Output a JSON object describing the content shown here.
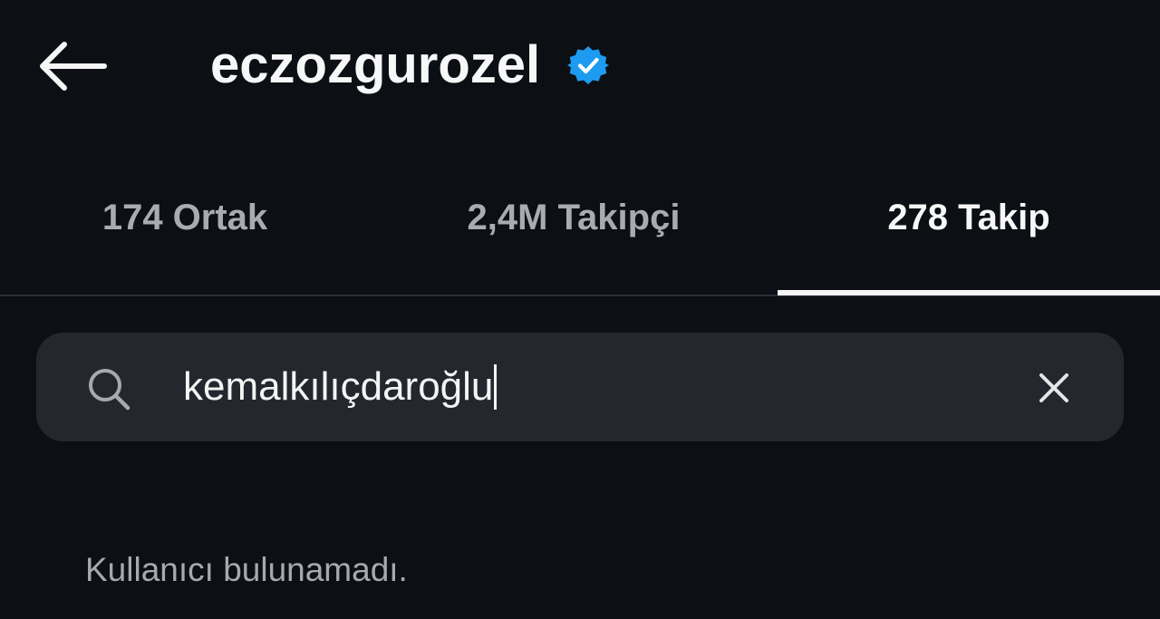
{
  "header": {
    "back_icon": "arrow-left-icon",
    "username": "eczozgurozel",
    "verified_icon": "verified-badge-icon",
    "verified_color": "#1d9bf0"
  },
  "tabs": [
    {
      "label": "174 Ortak",
      "active": false
    },
    {
      "label": "2,4M Takipçi",
      "active": false
    },
    {
      "label": "278 Takip",
      "active": true
    }
  ],
  "search": {
    "icon": "search-icon",
    "value": "kemalkılıçdaroğlu",
    "clear_icon": "close-icon"
  },
  "results": {
    "empty_message": "Kullanıcı bulunamadı."
  },
  "colors": {
    "background": "#0c0f14",
    "search_bg": "#24272e",
    "muted_text": "#a6a9b0",
    "primary_text": "#f5f5f5"
  }
}
